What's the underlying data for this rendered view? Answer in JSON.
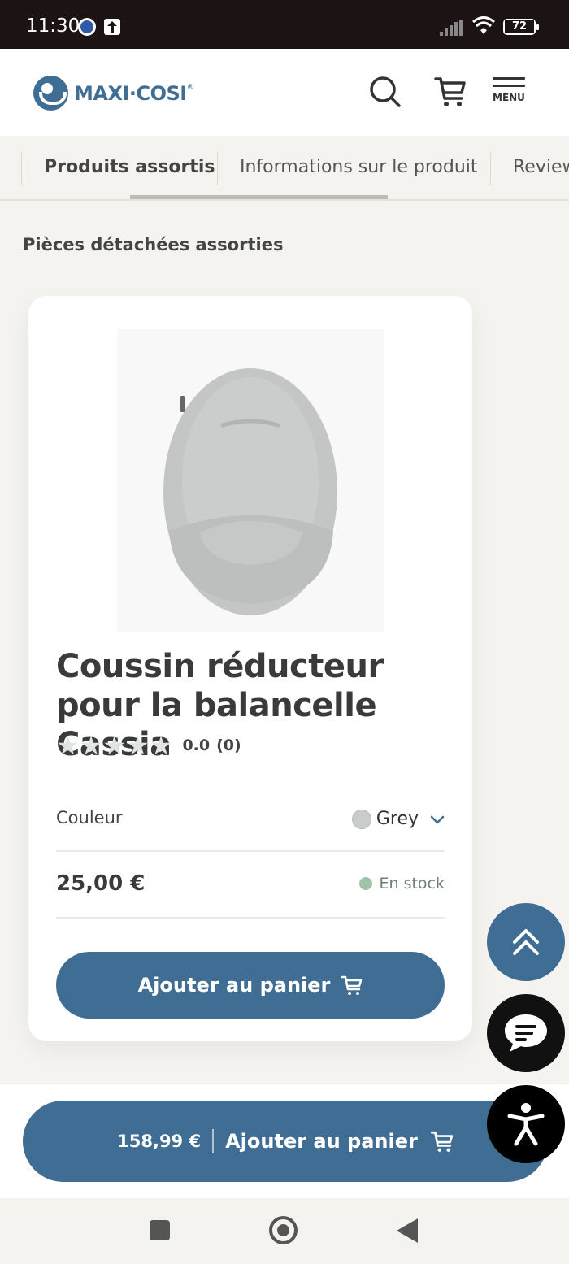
{
  "status_bar": {
    "time": "11:30",
    "battery": "72"
  },
  "header": {
    "logo_text": "MAXI·COSI",
    "logo_mark": "®",
    "menu_label": "MENU"
  },
  "tabs": [
    {
      "label": "Produits assortis",
      "active": true
    },
    {
      "label": "Informations sur le produit",
      "active": false
    },
    {
      "label": "Reviews",
      "active": false
    }
  ],
  "section_title": "Pièces détachées assorties",
  "product": {
    "title": "Coussin réducteur pour la balancelle Cassia",
    "rating_value": "0.0",
    "rating_count": "(0)",
    "rating_stars": 0,
    "color_label": "Couleur",
    "color_value": "Grey",
    "color_swatch": "#c9ccca",
    "price": "25,00 €",
    "stock": "En stock",
    "add_button": "Ajouter au panier"
  },
  "sticky_bar": {
    "price": "158,99 €",
    "label": "Ajouter au panier"
  },
  "colors": {
    "brand": "#3f6d93",
    "background": "#f4f3ef",
    "stock_dot": "#9fc3a8"
  },
  "icons": [
    "search-icon",
    "cart-icon",
    "menu-icon",
    "chevron-down-icon",
    "double-chevron-up-icon",
    "chat-icon",
    "accessibility-icon"
  ]
}
